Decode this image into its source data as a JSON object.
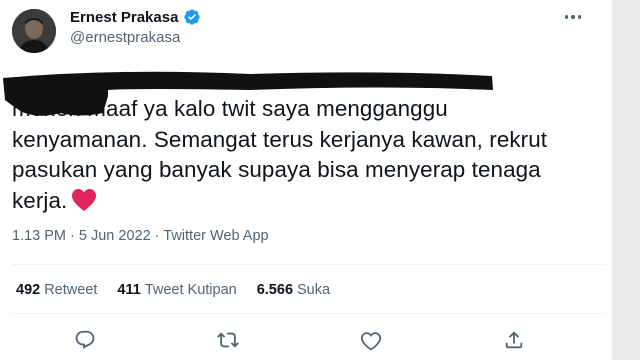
{
  "tweet": {
    "author": {
      "display_name": "Ernest Prakasa",
      "handle": "@ernestprakasa",
      "verified": true
    },
    "text": "mohon maaf ya kalo twit saya mengganggu\nkenyamanan. Semangat terus kerjanya kawan, rekrut\npasukan yang banyak supaya bisa menyerap tenaga\nkerja.",
    "emoji": "red-heart",
    "timestamp": "1.13 PM · 5 Jun 2022 · Twitter Web App",
    "stats": {
      "retweets": {
        "count": "492",
        "label": "Retweet"
      },
      "quotes": {
        "count": "411",
        "label": "Tweet Kutipan"
      },
      "likes": {
        "count": "6.566",
        "label": "Suka"
      }
    }
  },
  "icons": [
    "more-icon",
    "verified-badge-icon",
    "reply-icon",
    "retweet-icon",
    "like-icon",
    "share-icon"
  ],
  "colors": {
    "text": "#0f1419",
    "secondary": "#536471",
    "verified": "#1d9bf0",
    "heart": "#e0245e",
    "redaction": "#111111"
  }
}
